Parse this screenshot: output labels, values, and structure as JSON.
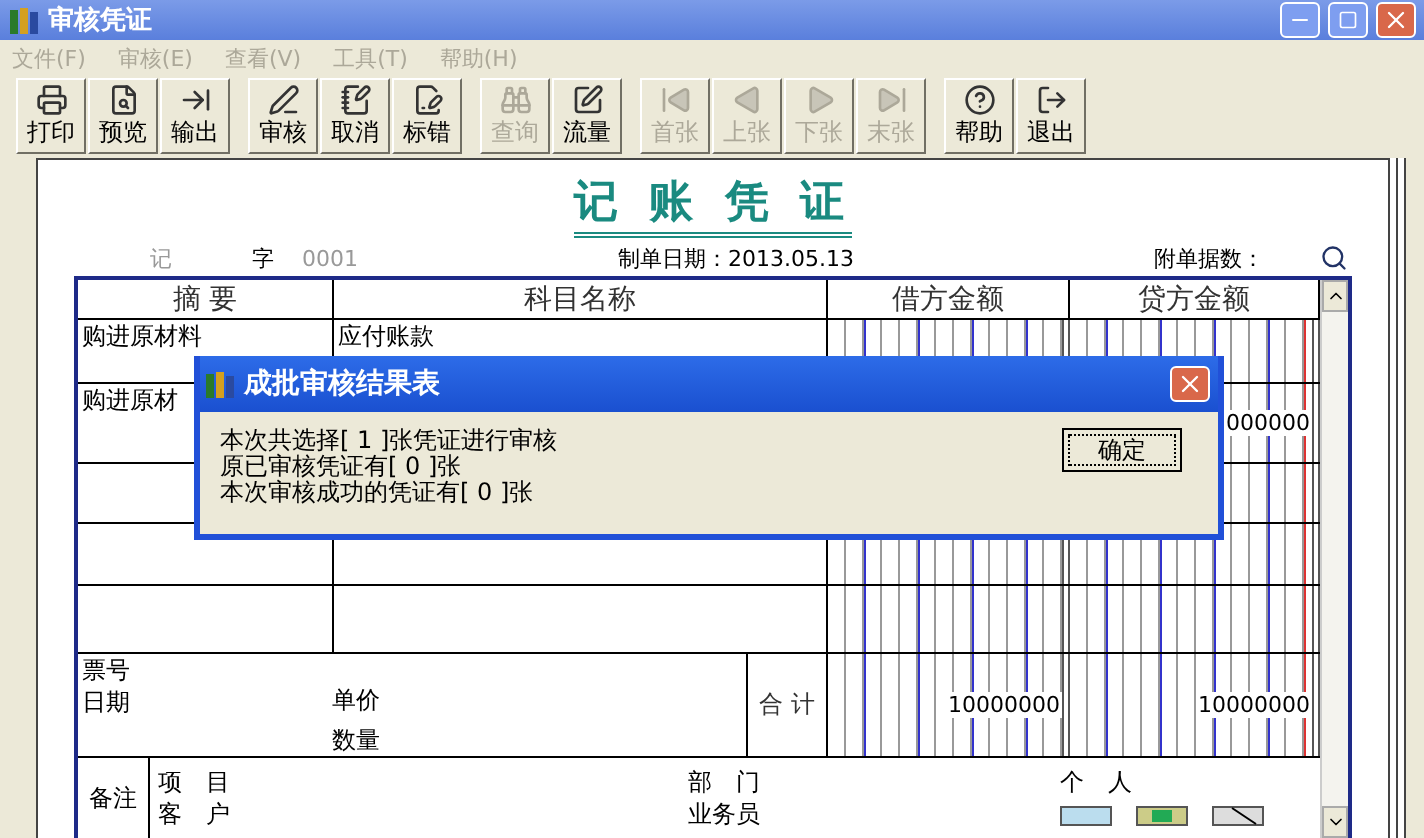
{
  "window": {
    "title": "审核凭证"
  },
  "menu": [
    {
      "label": "文件(F)",
      "disabled": true
    },
    {
      "label": "审核(E)",
      "disabled": true
    },
    {
      "label": "查看(V)",
      "disabled": true
    },
    {
      "label": "工具(T)",
      "disabled": true
    },
    {
      "label": "帮助(H)",
      "disabled": true
    }
  ],
  "toolbar": [
    [
      {
        "label": "打印",
        "disabled": false
      },
      {
        "label": "预览",
        "disabled": false
      },
      {
        "label": "输出",
        "disabled": false
      }
    ],
    [
      {
        "label": "审核",
        "disabled": false
      },
      {
        "label": "取消",
        "disabled": false
      },
      {
        "label": "标错",
        "disabled": false
      }
    ],
    [
      {
        "label": "查询",
        "disabled": true
      },
      {
        "label": "流量",
        "disabled": false
      }
    ],
    [
      {
        "label": "首张",
        "disabled": true
      },
      {
        "label": "上张",
        "disabled": true
      },
      {
        "label": "下张",
        "disabled": true
      },
      {
        "label": "末张",
        "disabled": true
      }
    ],
    [
      {
        "label": "帮助",
        "disabled": false
      },
      {
        "label": "退出",
        "disabled": false
      }
    ]
  ],
  "voucher": {
    "title": "记 账 凭 证",
    "type": "记",
    "type_suffix": "字",
    "number": "0001",
    "date": "制单日期：2013.05.13",
    "attachments": "附单据数：",
    "columns": [
      "摘 要",
      "科目名称",
      "借方金额",
      "贷方金额"
    ],
    "rows": [
      {
        "summary": "购进原材料",
        "account": "应付账款",
        "debit": "",
        "credit": ""
      },
      {
        "summary": "购进原材",
        "account": "",
        "debit": "",
        "credit": "000000"
      },
      {
        "summary": "",
        "account": "",
        "debit": "",
        "credit": ""
      },
      {
        "summary": "",
        "account": "",
        "debit": "",
        "credit": ""
      },
      {
        "summary": "",
        "account": "",
        "debit": "",
        "credit": ""
      }
    ],
    "footer": {
      "ticket": "票号",
      "date": "日期",
      "price": "单价",
      "quantity": "数量",
      "total_label": "合 计",
      "debit_total": "10000000",
      "credit_total": "10000000"
    },
    "remarks": {
      "label": "备注",
      "project": "项　目",
      "customer": "客　户",
      "department": "部　门",
      "salesperson": "业务员",
      "person": "个　人"
    }
  },
  "dialog": {
    "title": "成批审核结果表",
    "lines": [
      "本次共选择[ 1 ]张凭证进行审核",
      "原已审核凭证有[ 0 ]张",
      "本次审核成功的凭证有[ 0 ]张"
    ],
    "button": "确定"
  }
}
